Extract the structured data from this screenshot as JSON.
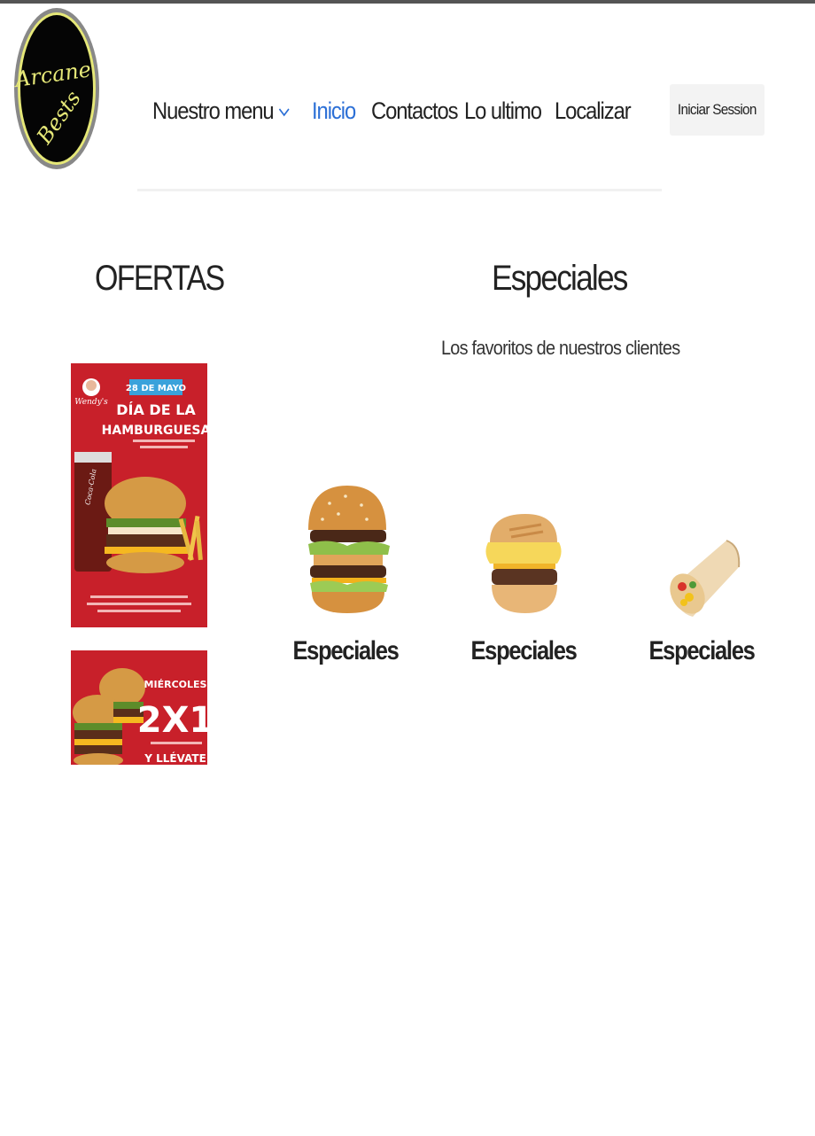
{
  "logo": {
    "line1": "Arcane",
    "line2": "Bests"
  },
  "nav": {
    "items": [
      {
        "label": "Nuestro menu",
        "icon": "chevron-down-icon"
      },
      {
        "label": "Inicio",
        "active": true
      },
      {
        "label": "Contactos"
      },
      {
        "label": "Lo ultimo"
      },
      {
        "label": "Localizar"
      }
    ],
    "active_color": "#2b6fd6",
    "login_label": "Iniciar Session"
  },
  "ofertas": {
    "title": "OFERTAS",
    "promo1": {
      "brand": "Wendy's",
      "date": "28 DE MAYO",
      "headline1": "DÍA DE LA",
      "headline2": "HAMBURGUESA",
      "drink": "Coca-Cola"
    },
    "promo2": {
      "day": "MIÉRCOLES",
      "deal": "2X1",
      "tagline": "Y LLÉVATE"
    }
  },
  "especiales": {
    "title": "Especiales",
    "subtitle": "Los favoritos de nuestros clientes",
    "cards": [
      {
        "label": "Especiales",
        "image": "burger-image"
      },
      {
        "label": "Especiales",
        "image": "breakfast-sandwich-image"
      },
      {
        "label": "Especiales",
        "image": "burrito-image"
      }
    ]
  },
  "colors": {
    "promo_red": "#c8202a",
    "accent_blue": "#2b6fd6",
    "button_bg": "#f3f3f3"
  }
}
